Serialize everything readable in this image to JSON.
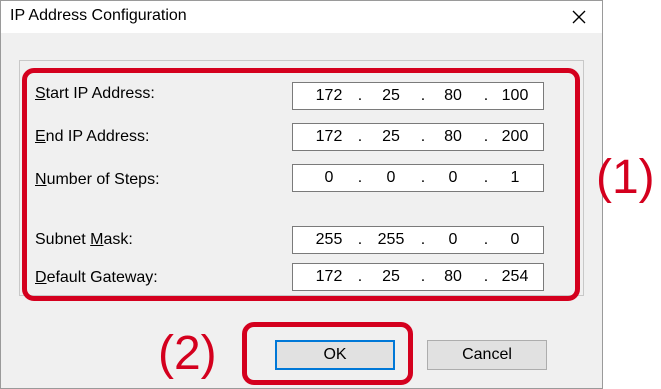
{
  "window": {
    "title": "IP Address Configuration",
    "close_glyph": "✕"
  },
  "fields": [
    {
      "label_ul": "S",
      "label_rest": "tart IP Address:",
      "octets": [
        "172",
        "25",
        "80",
        "100"
      ]
    },
    {
      "label_ul": "E",
      "label_rest": "nd IP Address:",
      "octets": [
        "172",
        "25",
        "80",
        "200"
      ]
    },
    {
      "label_ul": "N",
      "label_rest": "umber of Steps:",
      "octets": [
        "0",
        "0",
        "0",
        "1"
      ]
    },
    {
      "label_pre": "Subnet ",
      "label_ul": "M",
      "label_rest": "ask:",
      "octets": [
        "255",
        "255",
        "0",
        "0"
      ]
    },
    {
      "label_ul": "D",
      "label_rest": "efault Gateway:",
      "octets": [
        "172",
        "25",
        "80",
        "254"
      ]
    }
  ],
  "ip_separator": ".",
  "annotations": {
    "one": "(1)",
    "two": "(2)"
  },
  "buttons": {
    "ok": "OK",
    "cancel": "Cancel"
  },
  "colors": {
    "annotation": "#d4001e",
    "focus": "#0078d7"
  }
}
